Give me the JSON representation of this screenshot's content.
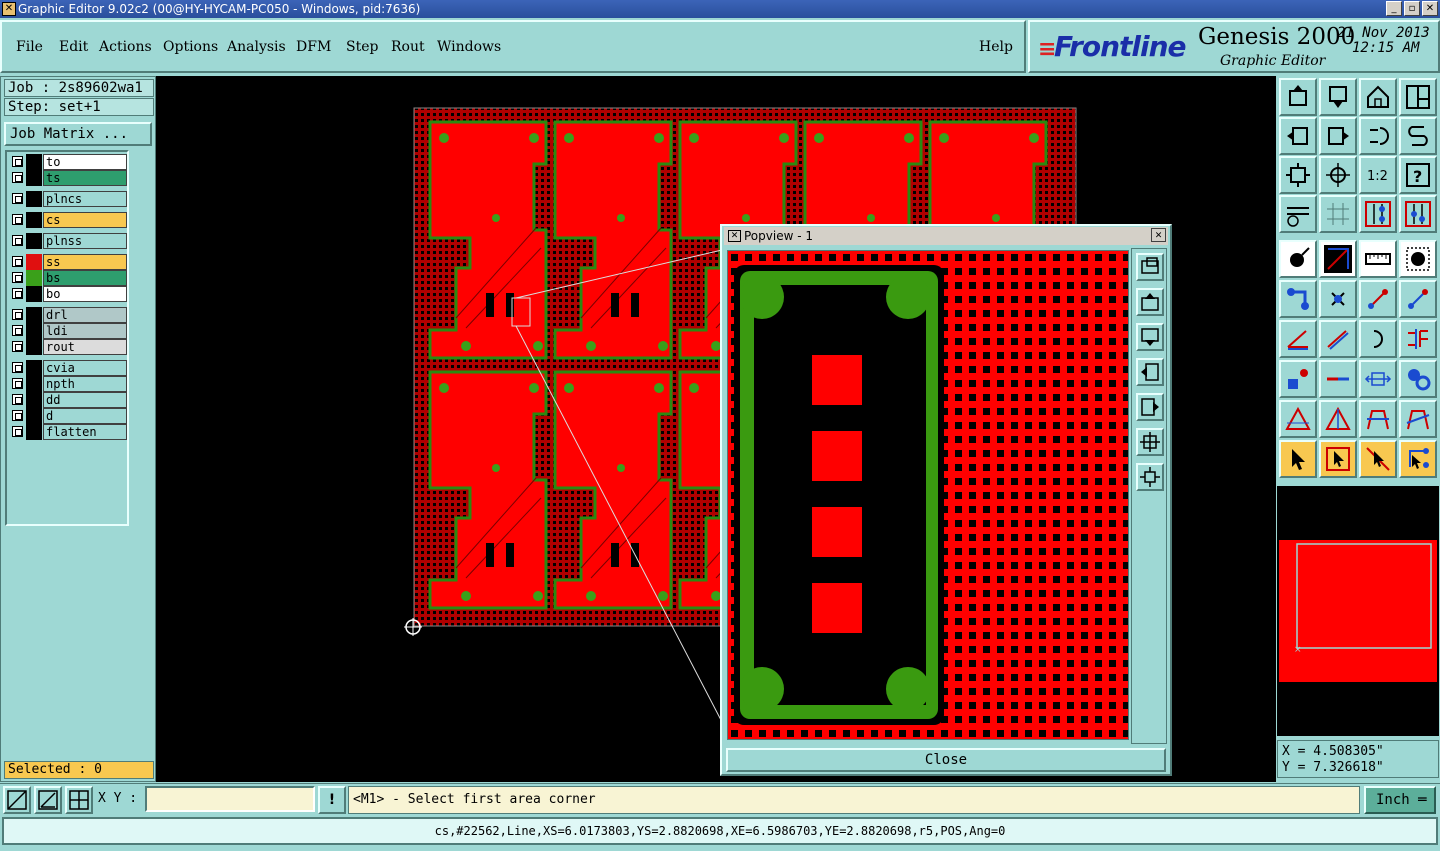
{
  "window": {
    "title": "Graphic Editor 9.02c2 (00@HY-HYCAM-PC050 - Windows, pid:7636)",
    "buttons": [
      "_",
      "▫",
      "✕"
    ]
  },
  "menu": {
    "items": [
      {
        "label": "File"
      },
      {
        "label": "Edit"
      },
      {
        "label": "Actions"
      },
      {
        "label": "Options"
      },
      {
        "label": "Analysis"
      },
      {
        "label": "DFM"
      },
      {
        "label": "Step"
      },
      {
        "label": "Rout"
      },
      {
        "label": "Windows"
      }
    ],
    "help": "Help"
  },
  "brand": {
    "logo": "Frontline",
    "product": "Genesis 2000",
    "subtitle": "Graphic Editor",
    "date": "21 Nov 2013",
    "time": "12:15 AM"
  },
  "left": {
    "job": "Job : 2s89602wa1",
    "step": "Step: set+1",
    "job_matrix": "Job Matrix ...",
    "selected": "Selected : 0",
    "layers": [
      {
        "name": "to",
        "bg": "#ffffff",
        "swatch": "#000000"
      },
      {
        "name": "ts",
        "bg": "#2e9e6e",
        "swatch": "#000000"
      },
      {
        "name": "plncs",
        "bg": "#9ed8d4",
        "swatch": "#000000"
      },
      {
        "name": "cs",
        "bg": "#f8c850",
        "swatch": "#000000"
      },
      {
        "name": "plnss",
        "bg": "#9ed8d4",
        "swatch": "#000000"
      },
      {
        "name": "ss",
        "bg": "#f8c850",
        "swatch": "#e01010"
      },
      {
        "name": "bs",
        "bg": "#2e9e6e",
        "swatch": "#3aa01a"
      },
      {
        "name": "bo",
        "bg": "#ffffff",
        "swatch": "#000000"
      },
      {
        "name": "drl",
        "bg": "#b0c8c8",
        "swatch": "#000000"
      },
      {
        "name": "ldi",
        "bg": "#b0c8c8",
        "swatch": "#000000"
      },
      {
        "name": "rout",
        "bg": "#dcdcdc",
        "swatch": "#000000"
      },
      {
        "name": "cvia",
        "bg": "#9ed8d4",
        "swatch": "#000000"
      },
      {
        "name": "npth",
        "bg": "#9ed8d4",
        "swatch": "#000000"
      },
      {
        "name": "dd",
        "bg": "#9ed8d4",
        "swatch": "#000000"
      },
      {
        "name": "d",
        "bg": "#9ed8d4",
        "swatch": "#000000"
      },
      {
        "name": "flatten",
        "bg": "#9ed8d4",
        "swatch": "#000000"
      }
    ]
  },
  "popview": {
    "title": "Popview - 1",
    "close_label": "Close"
  },
  "coords": {
    "x": "X = 4.508305\"",
    "y": "Y = 7.326618\""
  },
  "command": {
    "xy_label": "X Y :",
    "xy_value": "",
    "excl": "!",
    "prompt": "<M1> - Select first area corner",
    "unit": "Inch"
  },
  "status": "cs,#22562,Line,XS=6.0173803,YS=2.8820698,XE=6.5986703,YE=2.8820698,r5,POS,Ang=0",
  "colors": {
    "copper": "#ff0000",
    "mask": "#3a9a10",
    "background": "#000000",
    "panel": "#9ed8d4"
  }
}
